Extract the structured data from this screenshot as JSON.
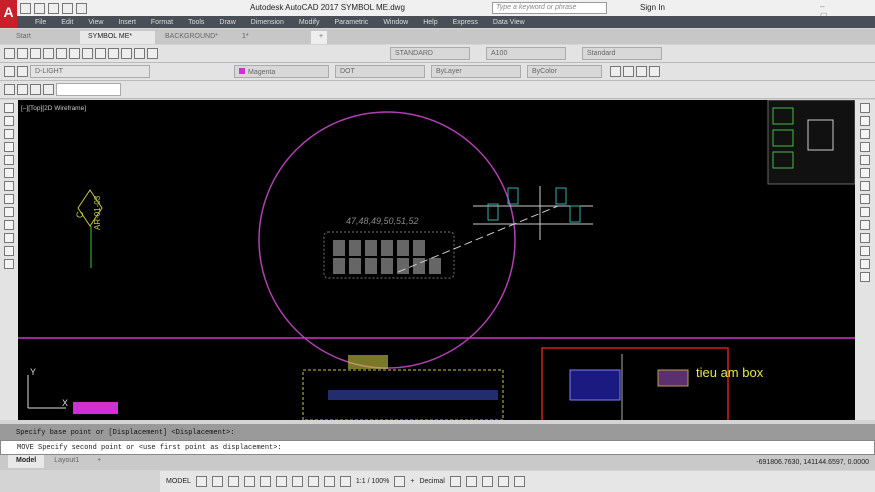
{
  "app": {
    "title": "Autodesk AutoCAD 2017   SYMBOL ME.dwg",
    "logo": "A",
    "search_placeholder": "Type a keyword or phrase",
    "sign_in": "Sign In",
    "window_controls": "– ▢ ✕"
  },
  "menu": [
    "File",
    "Edit",
    "View",
    "Insert",
    "Format",
    "Tools",
    "Draw",
    "Dimension",
    "Modify",
    "Parametric",
    "Window",
    "Help",
    "Express",
    "Data View"
  ],
  "tabs": [
    {
      "label": "Start"
    },
    {
      "label": "SYMBOL ME*",
      "active": true
    },
    {
      "label": "BACKGROUND*"
    },
    {
      "label": "1*"
    }
  ],
  "toolbar": {
    "text_style": "STANDARD",
    "dim_style": "A100",
    "table_style": "Standard",
    "layer": "D-LIGHT",
    "color": "Magenta",
    "linetype": "DOT",
    "lineweight": "ByLayer",
    "plotstyle": "ByColor"
  },
  "viewport": {
    "label": "[–][Top][2D Wireframe]",
    "annotation_numbers": "47,48,49,50,51,52",
    "section_mark_letter": "C",
    "section_mark_ref": "AR-01-03",
    "note_text": "tieu am box",
    "ucs_y": "Y",
    "ucs_x": "X"
  },
  "colors": {
    "canvas": "#000000",
    "circle": "#c040c0",
    "magenta_line": "#d030d0",
    "red_frame": "#d02020",
    "note": "#e8e840"
  },
  "command": {
    "history": "Specify base point or [Displacement] <Displacement>:",
    "prompt": "MOVE Specify second point or <use first point as displacement>:"
  },
  "layout_tabs": [
    "Model",
    "Layout1",
    "+"
  ],
  "coordinates": "-691806.7630, 141144.6597, 0.0000",
  "status": {
    "model": "MODEL",
    "scale": "1:1 / 100%",
    "units": "Decimal"
  }
}
